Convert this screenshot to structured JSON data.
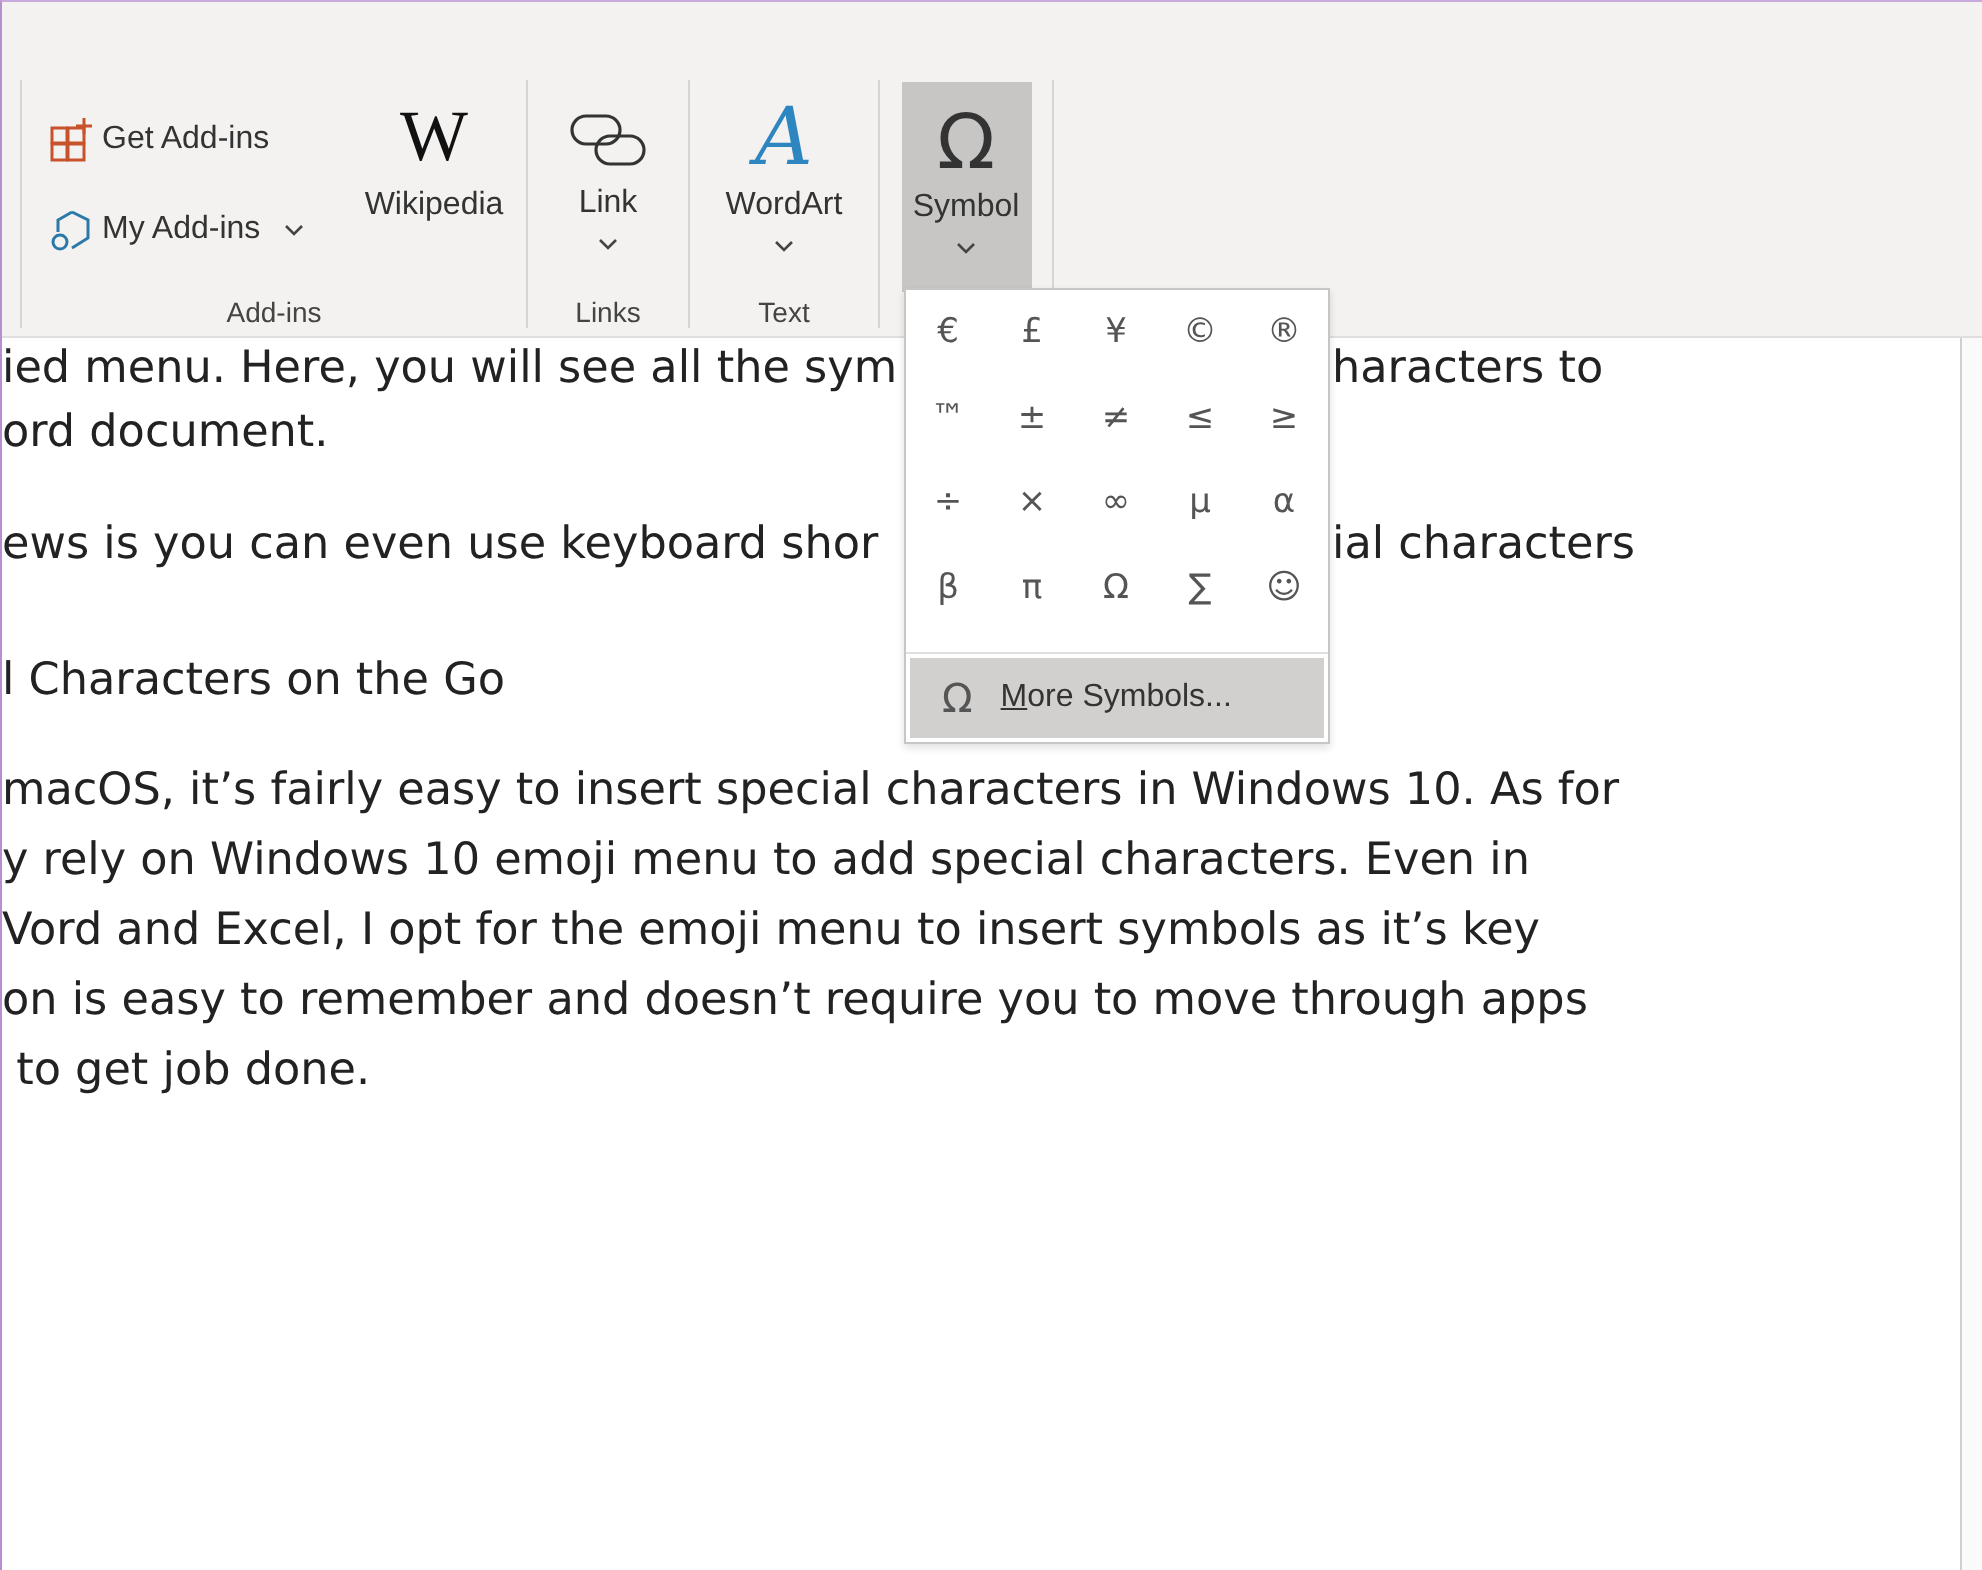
{
  "ribbon": {
    "add_ins": {
      "get_add_ins": "Get Add-ins",
      "my_add_ins": "My Add-ins",
      "wikipedia_logo": "W",
      "wikipedia": "Wikipedia",
      "label": "Add-ins"
    },
    "links": {
      "link": "Link",
      "label": "Links"
    },
    "text": {
      "wordart_logo": "A",
      "wordart": "WordArt",
      "label": "Text"
    },
    "symbol": {
      "icon_glyph": "Ω",
      "label": "Symbol",
      "selected": true
    }
  },
  "symbol_menu": {
    "symbols": [
      "€",
      "£",
      "¥",
      "©",
      "®",
      "™",
      "±",
      "≠",
      "≤",
      "≥",
      "÷",
      "×",
      "∞",
      "µ",
      "α",
      "β",
      "π",
      "Ω",
      "∑",
      "☺"
    ],
    "more": {
      "icon_glyph": "Ω",
      "label": "More Symbols...",
      "selected": true
    }
  },
  "document": {
    "paragraphs": [
      {
        "kind": "body",
        "lines": [
          [
            "ied menu. Here, you will see all the sym",
            "haracters to"
          ],
          [
            "ord document."
          ]
        ]
      },
      {
        "kind": "body",
        "lines": [
          [
            "ews is you can even use keyboard shor",
            "ial characters"
          ]
        ]
      },
      {
        "kind": "heading",
        "lines": [
          [
            "l Characters on the Go"
          ]
        ]
      },
      {
        "kind": "body",
        "lines": [
          [
            "macOS, it’s fairly easy to insert special characters in Windows 10. As for"
          ],
          [
            "y rely on Windows 10 emoji menu to add special characters. Even in"
          ],
          [
            "Vord and Excel, I opt for the emoji menu to insert symbols as it’s key"
          ],
          [
            "on is easy to remember and doesn’t require you to move through apps"
          ],
          [
            " to get job done."
          ]
        ]
      }
    ]
  }
}
